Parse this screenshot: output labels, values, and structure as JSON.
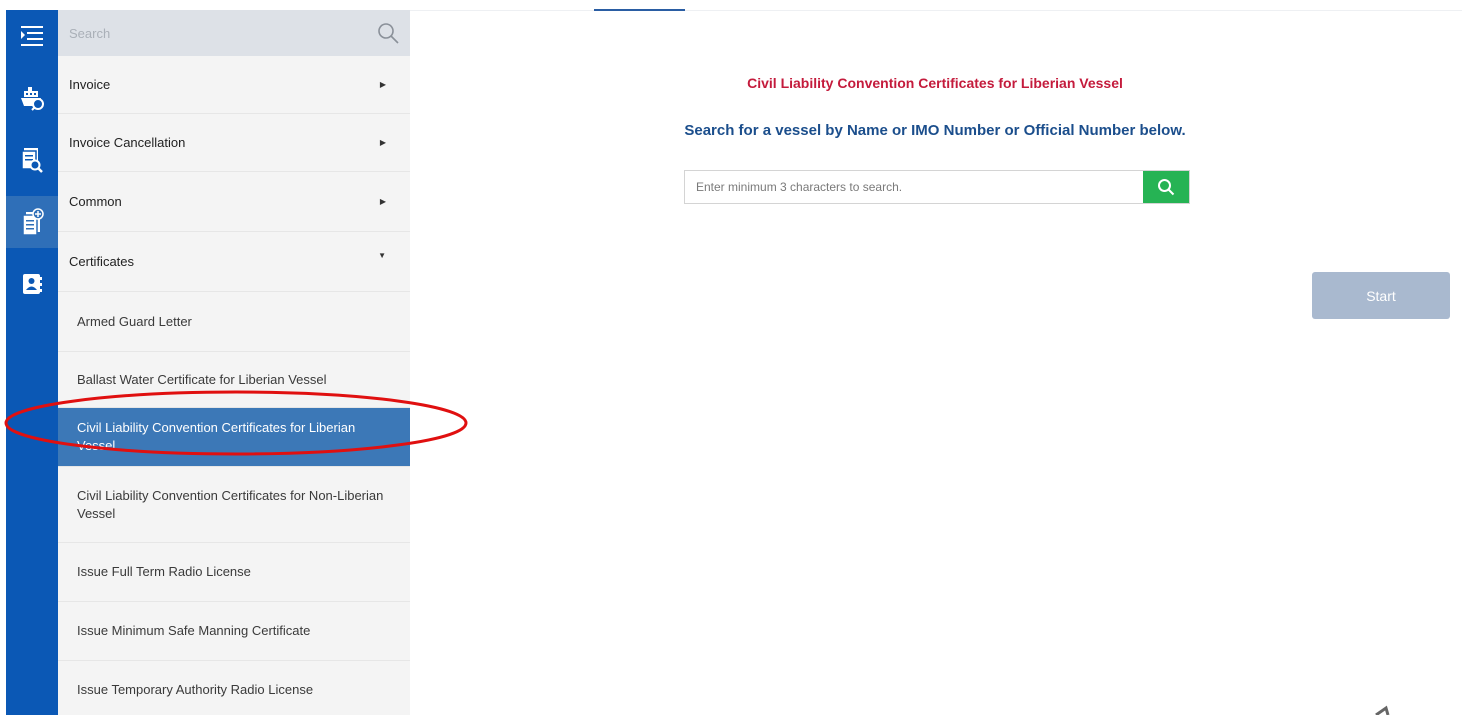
{
  "rail": {
    "icons": [
      "menu-toggle-icon",
      "ship-search-icon",
      "document-search-icon",
      "new-document-icon",
      "contacts-book-icon"
    ],
    "active": "new-document-icon"
  },
  "menu": {
    "search_placeholder": "Search",
    "groups": [
      {
        "label": "Invoice",
        "expanded": false
      },
      {
        "label": "Invoice Cancellation",
        "expanded": false
      },
      {
        "label": "Common",
        "expanded": false
      },
      {
        "label": "Certificates",
        "expanded": true
      }
    ],
    "certificates": [
      "Armed Guard Letter",
      "Ballast Water Certificate for Liberian Vessel",
      "Civil Liability Convention Certificates for Liberian Vessel",
      "Civil Liability Convention Certificates for Non-Liberian Vessel",
      "Issue Full Term Radio License",
      "Issue Minimum Safe Manning Certificate",
      "Issue Temporary Authority Radio License"
    ],
    "selected": "Civil Liability Convention Certificates for Liberian Vessel"
  },
  "main": {
    "title": "Civil Liability Convention Certificates for Liberian Vessel",
    "subtitle": "Search for a vessel by Name or IMO Number or Official Number below.",
    "search_placeholder": "Enter minimum 3 characters to search.",
    "start_label": "Start"
  },
  "colors": {
    "rail": "#0b58b5",
    "selected_item": "#3c78b7",
    "title": "#c41b3c",
    "subtitle": "#1b4e8c",
    "search_button": "#26b354",
    "start_disabled": "#a9b9cf",
    "annotation": "#e01010"
  }
}
